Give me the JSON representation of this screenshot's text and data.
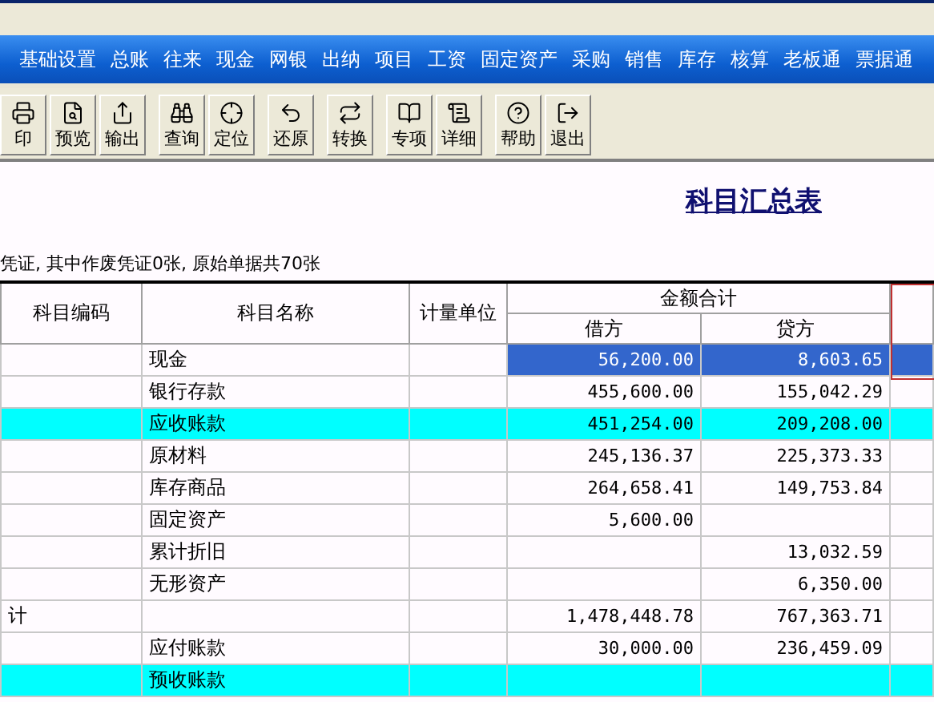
{
  "menu_bar": {
    "items": [
      "基础设置",
      "总账",
      "往来",
      "现金",
      "网银",
      "出纳",
      "项目",
      "工资",
      "固定资产",
      "采购",
      "销售",
      "库存",
      "核算",
      "老板通",
      "票据通"
    ]
  },
  "toolbar": {
    "groups": [
      [
        "印",
        "预览",
        "输出"
      ],
      [
        "查询",
        "定位"
      ],
      [
        "还原"
      ],
      [
        "转换"
      ],
      [
        "专项",
        "详细"
      ],
      [
        "帮助",
        "退出"
      ]
    ]
  },
  "report": {
    "title": "科目汇总表",
    "subtitle": "凭证, 其中作废凭证0张, 原始单据共70张"
  },
  "table": {
    "columns": {
      "code": "科目编码",
      "name": "科目名称",
      "unit": "计量单位",
      "amount": "金额合计",
      "debit": "借方",
      "credit": "贷方"
    },
    "rows": [
      {
        "code": "",
        "name": "现金",
        "debit": "56,200.00",
        "credit": "8,603.65",
        "selected": true,
        "marked": false
      },
      {
        "code": "",
        "name": "银行存款",
        "debit": "455,600.00",
        "credit": "155,042.29",
        "selected": false,
        "marked": false
      },
      {
        "code": "",
        "name": "应收账款",
        "debit": "451,254.00",
        "credit": "209,208.00",
        "selected": false,
        "marked": true
      },
      {
        "code": "",
        "name": "原材料",
        "debit": "245,136.37",
        "credit": "225,373.33",
        "selected": false,
        "marked": false
      },
      {
        "code": "",
        "name": "库存商品",
        "debit": "264,658.41",
        "credit": "149,753.84",
        "selected": false,
        "marked": false
      },
      {
        "code": "",
        "name": "固定资产",
        "debit": "5,600.00",
        "credit": "",
        "selected": false,
        "marked": false
      },
      {
        "code": "",
        "name": "累计折旧",
        "debit": "",
        "credit": "13,032.59",
        "selected": false,
        "marked": false
      },
      {
        "code": "",
        "name": "无形资产",
        "debit": "",
        "credit": "6,350.00",
        "selected": false,
        "marked": false
      },
      {
        "code": "计",
        "name": "",
        "debit": "1,478,448.78",
        "credit": "767,363.71",
        "selected": false,
        "marked": false
      },
      {
        "code": "",
        "name": "应付账款",
        "debit": "30,000.00",
        "credit": "236,459.09",
        "selected": false,
        "marked": false
      },
      {
        "code": "",
        "name": "预收账款",
        "debit": "",
        "credit": "",
        "selected": false,
        "marked": true
      }
    ]
  }
}
